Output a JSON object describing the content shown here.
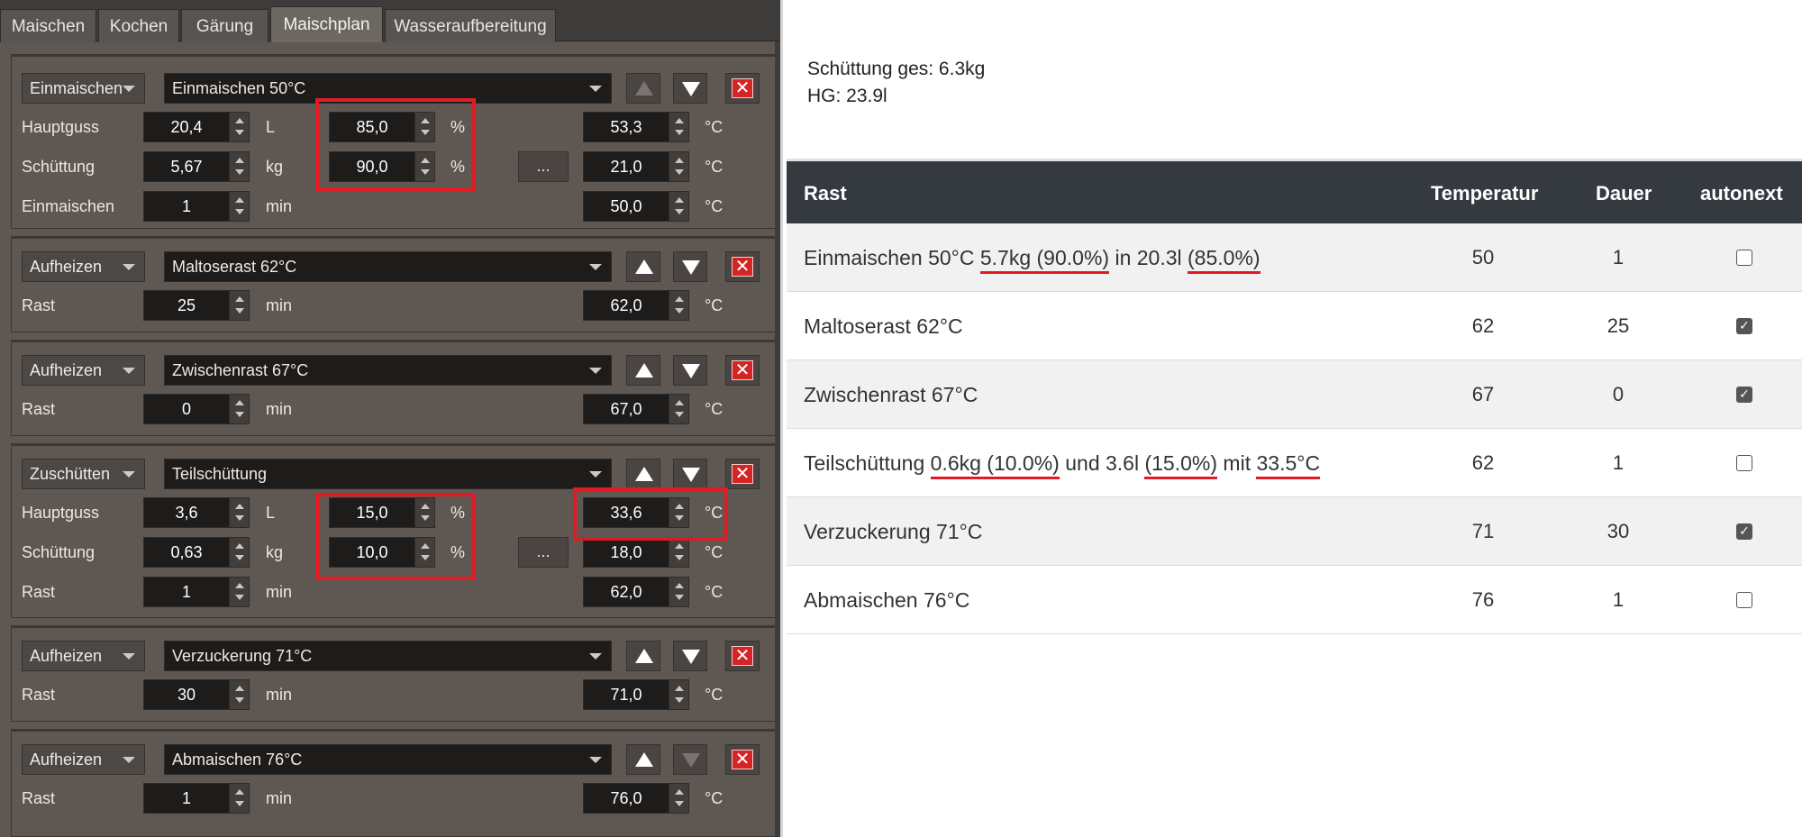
{
  "app": {
    "tabs": [
      "Maischen",
      "Kochen",
      "Gärung",
      "Maischplan",
      "Wasseraufbereitung"
    ],
    "active_tab": "Maischplan"
  },
  "steps": [
    {
      "type": "Einmaischen",
      "name": "Einmaischen 50°C",
      "up_enabled": false,
      "down_enabled": true,
      "rows": {
        "hauptguss": {
          "label": "Hauptguss",
          "value": "20,4",
          "unit": "L",
          "percent": "85,0",
          "percent_unit": "%",
          "temp": "53,3",
          "temp_unit": "°C"
        },
        "schuettung": {
          "label": "Schüttung",
          "value": "5,67",
          "unit": "kg",
          "percent": "90,0",
          "percent_unit": "%",
          "more": "...",
          "temp": "21,0",
          "temp_unit": "°C"
        },
        "rest": {
          "label": "Einmaischen",
          "value": "1",
          "unit": "min",
          "temp": "50,0",
          "temp_unit": "°C"
        }
      }
    },
    {
      "type": "Aufheizen",
      "name": "Maltoserast 62°C",
      "up_enabled": true,
      "down_enabled": true,
      "rows": {
        "rest": {
          "label": "Rast",
          "value": "25",
          "unit": "min",
          "temp": "62,0",
          "temp_unit": "°C"
        }
      }
    },
    {
      "type": "Aufheizen",
      "name": "Zwischenrast 67°C",
      "up_enabled": true,
      "down_enabled": true,
      "rows": {
        "rest": {
          "label": "Rast",
          "value": "0",
          "unit": "min",
          "temp": "67,0",
          "temp_unit": "°C"
        }
      }
    },
    {
      "type": "Zuschütten",
      "name": "Teilschüttung",
      "up_enabled": true,
      "down_enabled": true,
      "rows": {
        "hauptguss": {
          "label": "Hauptguss",
          "value": "3,6",
          "unit": "L",
          "percent": "15,0",
          "percent_unit": "%",
          "temp": "33,6",
          "temp_unit": "°C"
        },
        "schuettung": {
          "label": "Schüttung",
          "value": "0,63",
          "unit": "kg",
          "percent": "10,0",
          "percent_unit": "%",
          "more": "...",
          "temp": "18,0",
          "temp_unit": "°C"
        },
        "rest": {
          "label": "Rast",
          "value": "1",
          "unit": "min",
          "temp": "62,0",
          "temp_unit": "°C"
        }
      }
    },
    {
      "type": "Aufheizen",
      "name": "Verzuckerung 71°C",
      "up_enabled": true,
      "down_enabled": true,
      "rows": {
        "rest": {
          "label": "Rast",
          "value": "30",
          "unit": "min",
          "temp": "71,0",
          "temp_unit": "°C"
        }
      }
    },
    {
      "type": "Aufheizen",
      "name": "Abmaischen 76°C",
      "up_enabled": true,
      "down_enabled": false,
      "rows": {
        "rest": {
          "label": "Rast",
          "value": "1",
          "unit": "min",
          "temp": "76,0",
          "temp_unit": "°C"
        }
      }
    }
  ],
  "summary": {
    "schuettung": "Schüttung ges: 6.3kg",
    "hg": "HG: 23.9l"
  },
  "table": {
    "headers": {
      "rast": "Rast",
      "temperatur": "Temperatur",
      "dauer": "Dauer",
      "autonext": "autonext"
    },
    "rows": [
      {
        "segments": [
          {
            "text": "Einmaischen 50°C ",
            "underline": false
          },
          {
            "text": "5.7kg (90.0%)",
            "underline": true
          },
          {
            "text": " in 20.3l ",
            "underline": false
          },
          {
            "text": "(85.0%)",
            "underline": true
          }
        ],
        "temperatur": "50",
        "dauer": "1",
        "autonext": false
      },
      {
        "segments": [
          {
            "text": "Maltoserast 62°C",
            "underline": false
          }
        ],
        "temperatur": "62",
        "dauer": "25",
        "autonext": true
      },
      {
        "segments": [
          {
            "text": "Zwischenrast 67°C",
            "underline": false
          }
        ],
        "temperatur": "67",
        "dauer": "0",
        "autonext": true
      },
      {
        "segments": [
          {
            "text": "Teilschüttung ",
            "underline": false
          },
          {
            "text": "0.6kg (10.0%)",
            "underline": true
          },
          {
            "text": " und 3.6l ",
            "underline": false
          },
          {
            "text": "(15.0%)",
            "underline": true
          },
          {
            "text": " mit ",
            "underline": false
          },
          {
            "text": "33.5°C",
            "underline": true
          }
        ],
        "temperatur": "62",
        "dauer": "1",
        "autonext": false
      },
      {
        "segments": [
          {
            "text": "Verzuckerung 71°C",
            "underline": false
          }
        ],
        "temperatur": "71",
        "dauer": "30",
        "autonext": true
      },
      {
        "segments": [
          {
            "text": "Abmaischen 76°C",
            "underline": false
          }
        ],
        "temperatur": "76",
        "dauer": "1",
        "autonext": false
      }
    ]
  },
  "colors": {
    "highlight": "#e01b24",
    "header_bg": "#343a40",
    "panel_bg": "#5f5852"
  }
}
